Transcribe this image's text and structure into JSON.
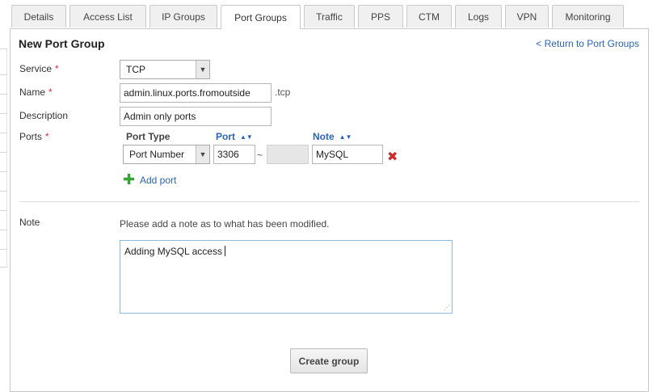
{
  "tabs": [
    "Details",
    "Access List",
    "IP Groups",
    "Port Groups",
    "Traffic",
    "PPS",
    "CTM",
    "Logs",
    "VPN",
    "Monitoring"
  ],
  "active_tab": "Port Groups",
  "form": {
    "title": "New Port Group",
    "return_link": "< Return to Port Groups",
    "required_mark": "*",
    "service": {
      "label": "Service",
      "value": "TCP"
    },
    "name": {
      "label": "Name",
      "value": "admin.linux.ports.fromoutside",
      "suffix": ".tcp"
    },
    "description": {
      "label": "Description",
      "value": "Admin only ports"
    },
    "ports": {
      "label": "Ports",
      "headers": {
        "type": "Port Type",
        "port": "Port",
        "note": "Note"
      },
      "rows": [
        {
          "type": "Port Number",
          "port_from": "3306",
          "separator": "~",
          "port_to": "",
          "note": "MySQL"
        }
      ],
      "add_label": "Add port"
    },
    "note": {
      "label": "Note",
      "hint": "Please add a note as to what has been modified.",
      "value": "Adding MySQL access"
    },
    "submit_label": "Create group"
  },
  "icons": {
    "dropdown": "chevron-down-icon",
    "sort": "sort-icon",
    "remove": "remove-x-icon",
    "add": "plus-icon",
    "resize": "resize-grip-icon"
  },
  "colors": {
    "link": "#2a64b3",
    "required": "#d4303a",
    "remove": "#cc2b2b",
    "add": "#3aa23a"
  }
}
